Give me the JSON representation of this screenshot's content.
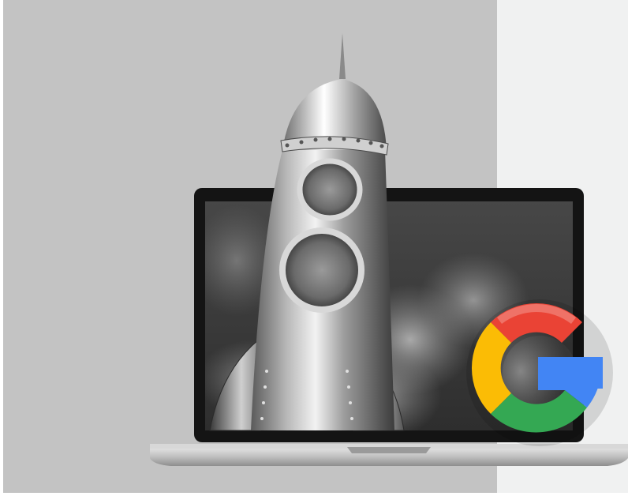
{
  "colors": {
    "left_panel": "#c3c3c3",
    "right_panel": "#f0f1f1",
    "laptop_bezel": "#151515",
    "laptop_screen": "#3f3f3f",
    "laptop_base": "#bdbdbd",
    "rocket_metal": "#8d8d8d",
    "google_red": "#ea4335",
    "google_yellow": "#fbbc05",
    "google_green": "#34a853",
    "google_blue": "#4285f4"
  },
  "icons": {
    "rocket": "rocket-icon",
    "laptop": "laptop-icon",
    "google": "google-g-logo"
  }
}
